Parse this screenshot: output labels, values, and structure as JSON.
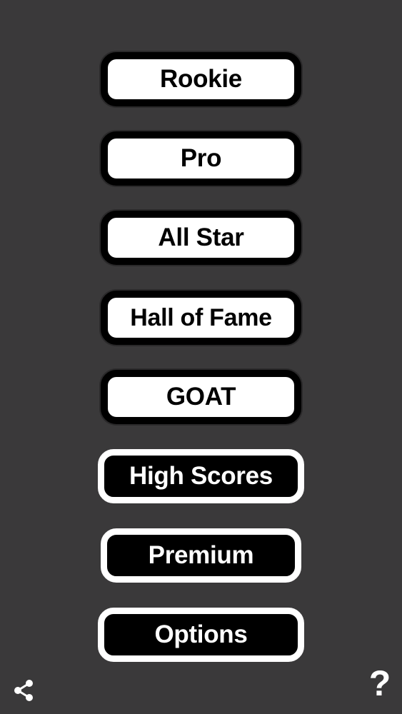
{
  "menu": {
    "rookie": "Rookie",
    "pro": "Pro",
    "all_star": "All Star",
    "hall_of_fame": "Hall of Fame",
    "goat": "GOAT",
    "high_scores": "High Scores",
    "premium": "Premium",
    "options": "Options"
  },
  "footer": {
    "share_icon": "share-icon",
    "help_label": "?"
  },
  "colors": {
    "background": "#3a393a",
    "button_light_face": "#ffffff",
    "button_dark_face": "#000000"
  }
}
